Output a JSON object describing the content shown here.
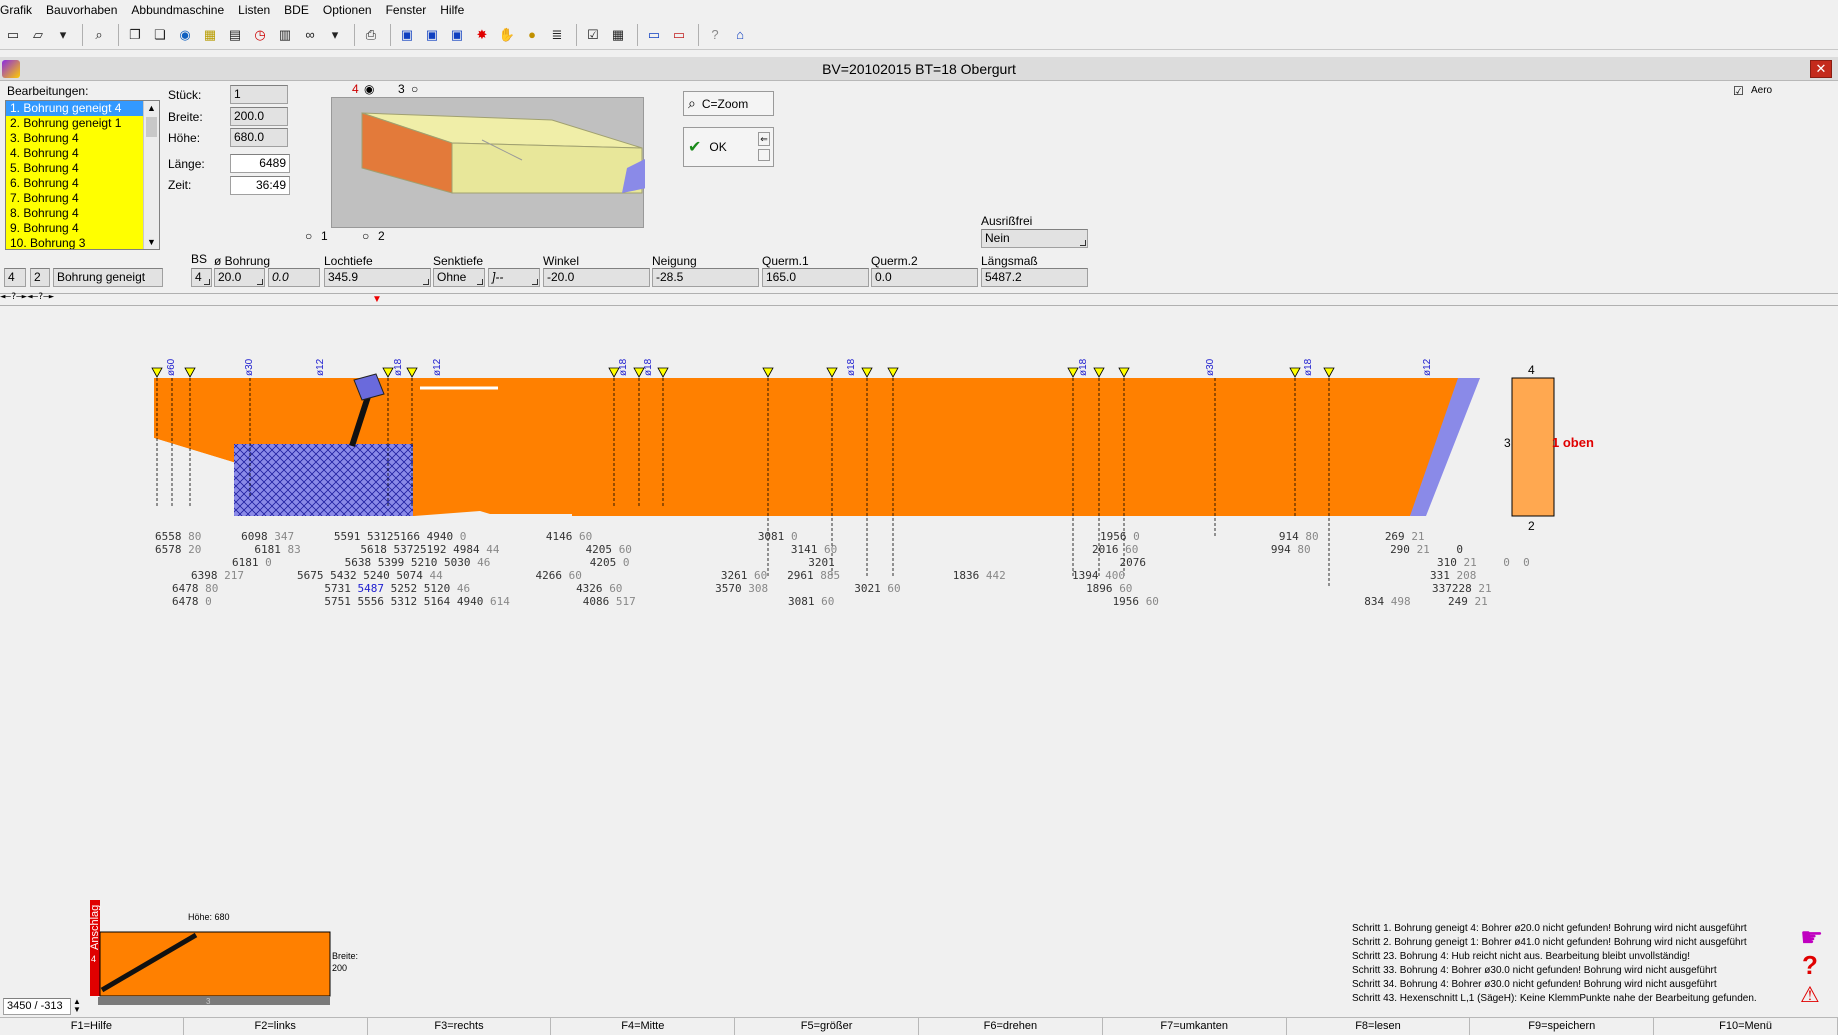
{
  "menu": [
    "Grafik",
    "Bauvorhaben",
    "Abbundmaschine",
    "Listen",
    "BDE",
    "Optionen",
    "Fenster",
    "Hilfe"
  ],
  "window": {
    "title": "BV=20102015  BT=18 Obergurt",
    "close": "✕"
  },
  "list": {
    "label": "Bearbeitungen:",
    "items": [
      "1. Bohrung geneigt 4",
      "2. Bohrung geneigt 1",
      "3. Bohrung 4",
      "4. Bohrung 4",
      "5. Bohrung 4",
      "6. Bohrung 4",
      "7. Bohrung 4",
      "8. Bohrung 4",
      "9. Bohrung 4",
      "10. Bohrung 3"
    ]
  },
  "props": {
    "stueck_label": "Stück:",
    "stueck": "1",
    "breite_label": "Breite:",
    "breite": "200.0",
    "hoehe_label": "Höhe:",
    "hoehe": "680.0",
    "laenge_label": "Länge:",
    "laenge": "6489",
    "zeit_label": "Zeit:",
    "zeit": "36:49"
  },
  "view_radios": {
    "r4": "4",
    "r3": "3",
    "r1": "1",
    "r2": "2"
  },
  "buttons": {
    "zoom": "C=Zoom",
    "ok": "OK"
  },
  "aero_label": "Aero",
  "ausriss": {
    "label": "Ausrißfrei",
    "value": "Nein"
  },
  "params": {
    "bs_label": "BS",
    "col_bohrung": "ø Bohrung",
    "col_lochtiefe": "Lochtiefe",
    "col_senktiefe": "Senktiefe",
    "col_winkel": "Winkel",
    "col_neigung": "Neigung",
    "col_querm1": "Querm.1",
    "col_querm2": "Querm.2",
    "col_laengsmass": "Längsmaß",
    "f_num": "4",
    "f_side": "2",
    "f_type": "Bohrung geneigt",
    "f_bs": "4",
    "f_bohrung": "20.0",
    "f_bohrung2": "0.0",
    "f_lochtiefe": "345.9",
    "f_senktiefe": "Ohne",
    "f_senk2": "]--",
    "f_winkel": "-20.0",
    "f_neigung": "-28.5",
    "f_querm1": "165.0",
    "f_querm2": "0.0",
    "f_laengsmass": "5487.2"
  },
  "drawing": {
    "side_top": "4",
    "side_bottom": "2",
    "side_left": "3",
    "oben": "1 oben",
    "dims_row1": [
      "6558",
      "80",
      "6098",
      "347",
      "5591",
      "5312",
      "5166",
      "4940",
      "0",
      "4146",
      "60",
      "3081",
      "0",
      "1956",
      "0",
      "914",
      "80",
      "269",
      "21"
    ],
    "dims_row2": [
      "6578",
      "20",
      "6181",
      "83",
      "5618",
      "5372",
      "5192",
      "4984",
      "44",
      "4205",
      "60",
      "3141",
      "60",
      "2016",
      "60",
      "994",
      "80",
      "290",
      "21",
      "0"
    ],
    "dims_row3": [
      "6181",
      "0",
      "5638",
      "5399",
      "5210",
      "5030",
      "46",
      "4205",
      "0",
      "3201",
      "2076",
      "310",
      "21",
      "0",
      "0"
    ],
    "dims_row4": [
      "6398",
      "217",
      "5675",
      "5432",
      "5240",
      "5074",
      "44",
      "4266",
      "60",
      "3261",
      "60",
      "2961",
      "885",
      "1836",
      "442",
      "1394",
      "400",
      "331",
      "208"
    ],
    "dims_row5": [
      "6478",
      "80",
      "5731",
      "5487",
      "5252",
      "5120",
      "46",
      "4326",
      "60",
      "3570",
      "308",
      "3021",
      "60",
      "1896",
      "60",
      "337",
      "228",
      "21"
    ],
    "dims_row6": [
      "6478",
      "0",
      "5751",
      "5556",
      "5312",
      "5164",
      "4940",
      "614",
      "4086",
      "517",
      "3081",
      "60",
      "1956",
      "60",
      "834",
      "498",
      "249",
      "21"
    ],
    "arrows_left": "◄–?–►◄–?–►",
    "diameters": [
      "ø60",
      "ø30",
      "ø12",
      "ø18",
      "ø12",
      "ø18",
      "ø18",
      "ø18",
      "ø18",
      "ø30",
      "ø18",
      "ø12"
    ]
  },
  "mini": {
    "hoehe": "Höhe: 680",
    "breite": "Breite:\n200",
    "anschlag": "Anschlag",
    "num_4": "4",
    "num_3": "3",
    "coord": "3450 / -313"
  },
  "messages": [
    "Schritt  1. Bohrung geneigt 4: Bohrer ø20.0 nicht gefunden! Bohrung wird nicht ausgeführt",
    "Schritt  2. Bohrung geneigt 1: Bohrer ø41.0 nicht gefunden! Bohrung wird nicht ausgeführt",
    "Schritt 23. Bohrung 4: Hub reicht nicht aus.  Bearbeitung bleibt unvollständig!",
    "Schritt 33. Bohrung 4: Bohrer ø30.0 nicht gefunden! Bohrung wird nicht ausgeführt",
    "Schritt 34. Bohrung 4: Bohrer ø30.0 nicht gefunden! Bohrung wird nicht ausgeführt",
    "Schritt 43. Hexenschnitt L,1 (SägeH): Keine KlemmPunkte nahe der Bearbeitung gefunden."
  ],
  "fkeys": [
    "F1=Hilfe",
    "F2=links",
    "F3=rechts",
    "F4=Mitte",
    "F5=größer",
    "F6=drehen",
    "F7=umkanten",
    "F8=lesen",
    "F9=speichern",
    "F10=Menü"
  ]
}
